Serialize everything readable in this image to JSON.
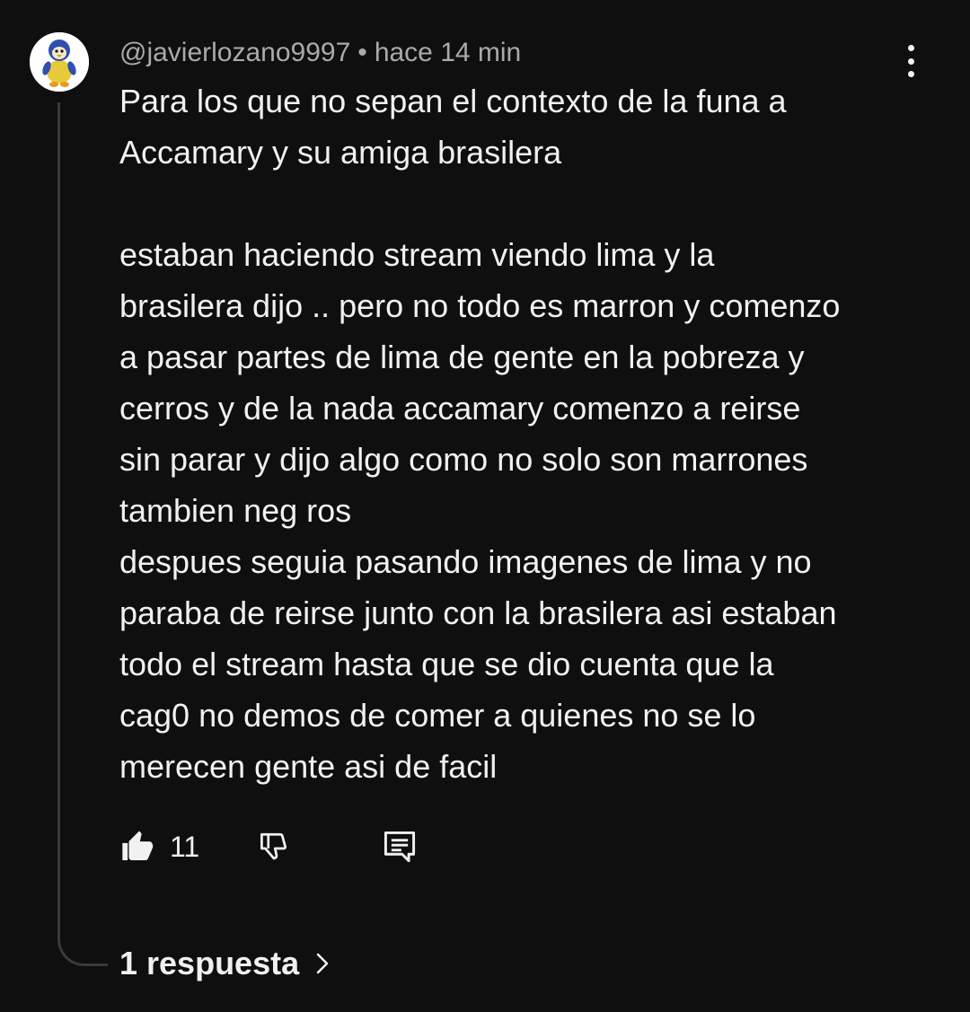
{
  "comment": {
    "author": "@javierlozano9997",
    "separator": "•",
    "timestamp": "hace 14 min",
    "avatar_icon": "baby-penguin-avatar",
    "lines": [
      "Para los que no sepan el contexto de la funa a",
      "Accamary y su amiga brasilera",
      "",
      "estaban haciendo stream viendo lima y la",
      "brasilera dijo .. pero no todo es marron y comenzo",
      "a pasar partes de lima de gente en la pobreza y",
      "cerros y de la nada accamary comenzo a reirse",
      "sin parar y dijo algo como no solo son marrones",
      "tambien neg ros",
      "despues seguia pasando imagenes de lima y no",
      "paraba de reirse junto con la brasilera asi estaban",
      "todo el stream hasta que se dio cuenta que la",
      "cag0 no demos de comer a quienes no se lo",
      "merecen gente asi de facil"
    ],
    "like_count": "11",
    "replies_label": "1 respuesta"
  },
  "icons": {
    "like": "thumbs-up-filled-icon",
    "dislike": "thumbs-down-icon",
    "reply": "comment-reply-icon",
    "menu": "more-vertical-icon",
    "replies_chevron": "chevron-right-icon"
  },
  "colors": {
    "background": "#0f0f0f",
    "text": "#f1f1f1",
    "meta_text": "#aaaaaa",
    "thread_line": "#3a3a3a"
  }
}
